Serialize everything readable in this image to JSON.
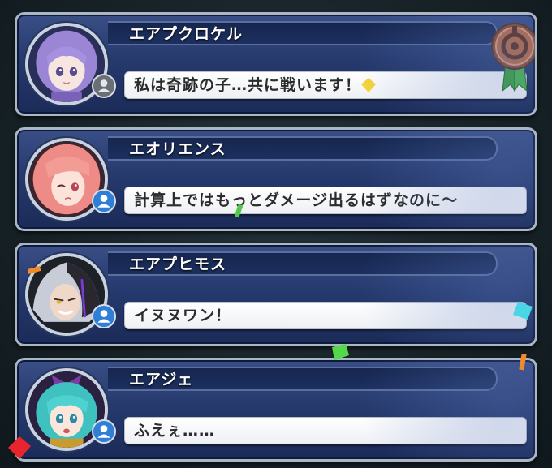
{
  "players": [
    {
      "name": "エアプクロケル",
      "message": "私は奇跡の子…共に戦います！",
      "status_icon": "user-offline-icon",
      "avatar": "purple-hair-character-portrait",
      "hair_color": "#9b86d6",
      "has_medal": true
    },
    {
      "name": "エオリエンス",
      "message": "計算上ではもっとダメージ出るはずなのに～",
      "status_icon": "user-online-icon",
      "avatar": "pink-hair-character-portrait",
      "hair_color": "#ef8b86",
      "has_medal": false
    },
    {
      "name": "エアプヒモス",
      "message": "イヌヌワン！",
      "status_icon": "user-online-icon",
      "avatar": "silver-black-hair-character-portrait",
      "hair_color": "#c7ccd6",
      "has_medal": false
    },
    {
      "name": "エアジェ",
      "message": "ふえぇ……",
      "status_icon": "user-online-icon",
      "avatar": "teal-hair-character-portrait",
      "hair_color": "#3fc1c0",
      "has_medal": false
    }
  ],
  "medal": {
    "icon": "bronze-rank-medal-icon",
    "color": "#c0693b"
  },
  "colors": {
    "panel": "#263a6e",
    "panel_border": "#aab6c6",
    "bubble": "#ffffff",
    "online": "#2f7fd6",
    "offline": "#6a6f76"
  }
}
